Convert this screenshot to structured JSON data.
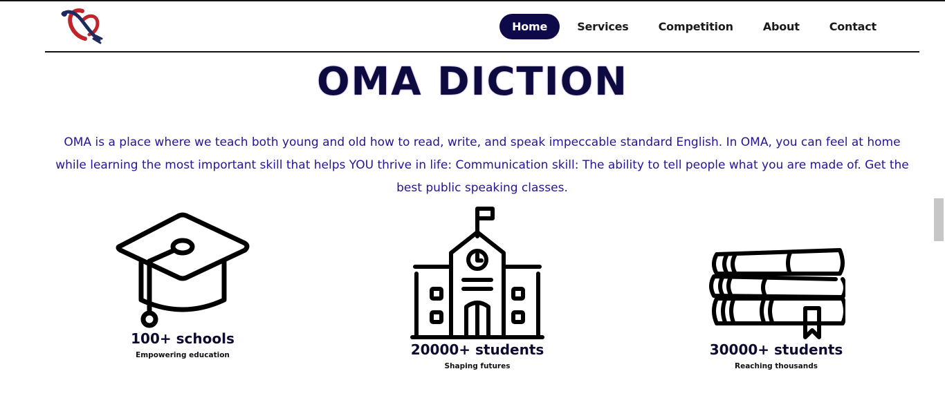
{
  "nav": {
    "items": [
      {
        "label": "Home",
        "active": true
      },
      {
        "label": "Services",
        "active": false
      },
      {
        "label": "Competition",
        "active": false
      },
      {
        "label": "About",
        "active": false
      },
      {
        "label": "Contact",
        "active": false
      }
    ]
  },
  "hero": {
    "title": "OMA DICTION",
    "intro": "OMA is a place where we teach both young and old how to read, write, and speak impeccable standard English. In OMA, you can feel at home while learning the most important skill that helps YOU thrive in life: Communication skill: The ability to tell people what you are made of. Get the best public speaking classes."
  },
  "stats": [
    {
      "icon": "graduation-cap-icon",
      "value": "100+ schools",
      "caption": "Empowering education"
    },
    {
      "icon": "school-building-icon",
      "value": "20000+ students",
      "caption": "Shaping futures"
    },
    {
      "icon": "books-stack-icon",
      "value": "30000+ students",
      "caption": "Reaching thousands"
    }
  ],
  "colors": {
    "nav_active_bg": "#0e0a4a",
    "title": "#0c0a3e",
    "intro_text": "#2a119a",
    "logo_red": "#c0242b",
    "logo_navy": "#1d2a5e"
  }
}
